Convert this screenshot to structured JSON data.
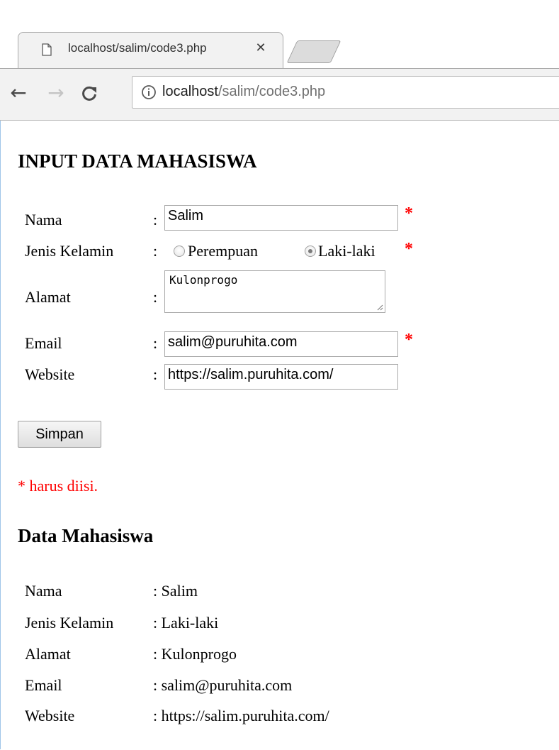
{
  "browser": {
    "tab_title": "localhost/salim/code3.php",
    "tab_close": "✕",
    "url_host": "localhost",
    "url_path": "/salim/code3.php",
    "back_glyph": "←",
    "forward_glyph": "→",
    "icons": [
      "page-icon",
      "close-icon",
      "back-arrow-icon",
      "forward-arrow-icon",
      "reload-icon",
      "info-icon"
    ]
  },
  "form": {
    "title": "INPUT DATA MAHASISWA",
    "colon": ":",
    "required_mark": "*",
    "nama": {
      "label": "Nama",
      "value": "Salim"
    },
    "jenis_kelamin": {
      "label": "Jenis Kelamin",
      "options": [
        "Perempuan",
        "Laki-laki"
      ],
      "selected": "Laki-laki"
    },
    "alamat": {
      "label": "Alamat",
      "value": "Kulonprogo"
    },
    "email": {
      "label": "Email",
      "value": "salim@puruhita.com"
    },
    "website": {
      "label": "Website",
      "value": "https://salim.puruhita.com/"
    },
    "submit_label": "Simpan",
    "required_note": "* harus diisi."
  },
  "output": {
    "title": "Data Mahasiswa",
    "rows": [
      {
        "label": "Nama",
        "value": ": Salim"
      },
      {
        "label": "Jenis Kelamin",
        "value": ": Laki-laki"
      },
      {
        "label": "Alamat",
        "value": ": Kulonprogo"
      },
      {
        "label": "Email",
        "value": ": salim@puruhita.com"
      },
      {
        "label": "Website",
        "value": ": https://salim.puruhita.com/"
      }
    ]
  },
  "colors": {
    "required": "#ff0000",
    "chrome_bg": "#f2f2f2",
    "page_bg": "#ffffff"
  }
}
